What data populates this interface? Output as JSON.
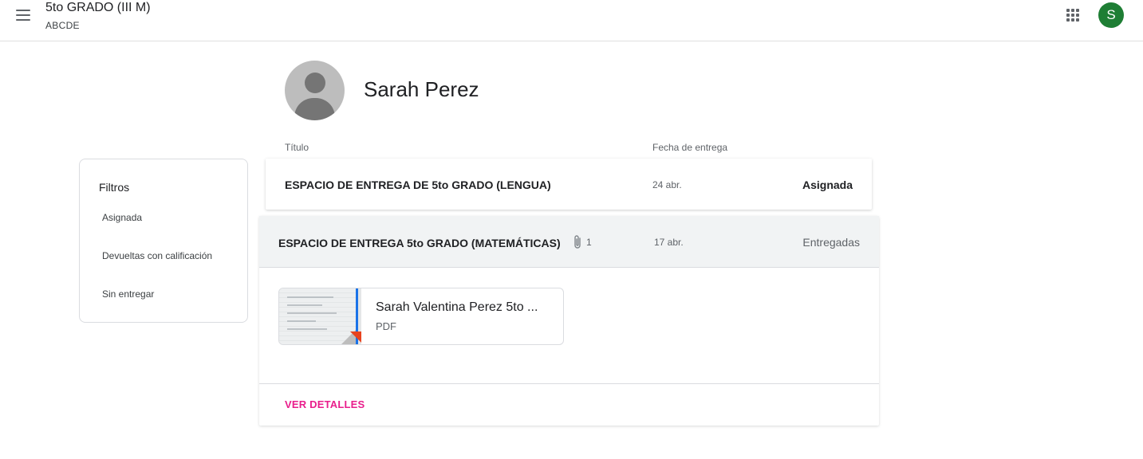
{
  "header": {
    "class_title": "5to GRADO (III M)",
    "class_subtitle": "ABCDE",
    "account_initial": "S",
    "account_color": "#1e7e34",
    "menu_icon": "hamburger-menu-icon",
    "apps_icon": "apps-grid-icon"
  },
  "student": {
    "name": "Sarah Perez",
    "avatar_icon": "default-person-avatar"
  },
  "columns": {
    "title": "Título",
    "due_date": "Fecha de entrega"
  },
  "filters": {
    "title": "Filtros",
    "items": [
      {
        "label": "Asignada"
      },
      {
        "label": "Devueltas con calificación"
      },
      {
        "label": "Sin entregar"
      }
    ]
  },
  "assignments": [
    {
      "title": "ESPACIO DE ENTREGA DE 5to GRADO (LENGUA)",
      "due_date": "24 abr.",
      "status": "Asignada"
    },
    {
      "title": "ESPACIO DE ENTREGA 5to GRADO (MATEMÁTICAS)",
      "attachment_count": "1",
      "due_date": "17 abr.",
      "status": "Entregadas",
      "attachment": {
        "name": "Sarah Valentina Perez 5to ...",
        "type": "PDF"
      },
      "details_label": "VER DETALLES"
    }
  ],
  "colors": {
    "details_link": "#e91e8c",
    "expanded_header_bg": "#f1f3f4",
    "pdf_badge": "#e8431f"
  }
}
